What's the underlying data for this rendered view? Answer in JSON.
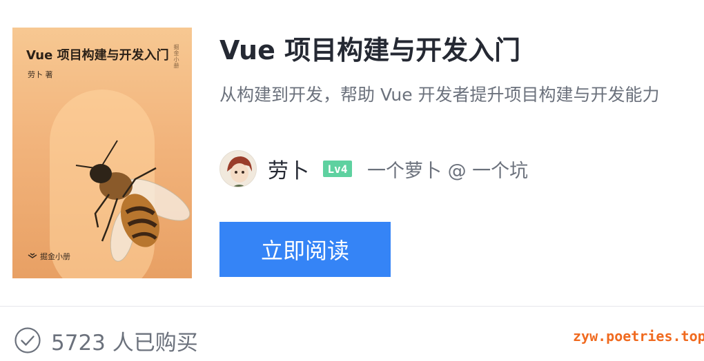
{
  "cover": {
    "title": "Vue 项目构建与开发入门",
    "author": "劳卜 著",
    "spine_text": "掘金小册",
    "publisher": "掘金小册",
    "colors": {
      "top": "#f7c892",
      "bottom": "#e8a064"
    }
  },
  "book": {
    "title": "Vue 项目构建与开发入门",
    "description": "从构建到开发，帮助 Vue 开发者提升项目构建与开发能力"
  },
  "author": {
    "name": "劳卜",
    "level": "Lv4",
    "bio": "一个萝卜 @ 一个坑"
  },
  "actions": {
    "read_label": "立即阅读"
  },
  "footer": {
    "purchase_count": "5723 人已购买"
  },
  "watermark": "zyw.poetries.top",
  "colors": {
    "accent": "#3584f6",
    "level_badge": "#5ed1a0",
    "watermark": "#f06a1f"
  }
}
